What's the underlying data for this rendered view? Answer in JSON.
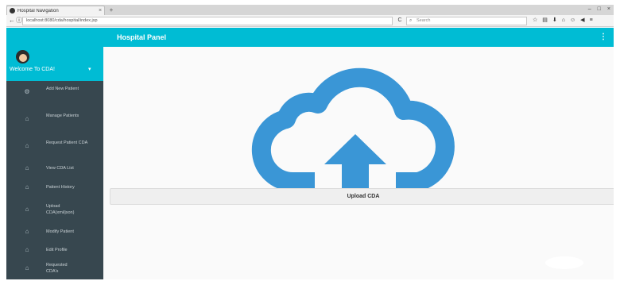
{
  "browser": {
    "tab_title": "Hospital Navigation",
    "tab_close": "×",
    "new_tab": "+",
    "window_controls": [
      "–",
      "□",
      "×"
    ],
    "back": "←",
    "info": "ⓘ",
    "url": "localhost:8080/cda/hospital/index.jsp",
    "reload": "C",
    "search_placeholder": "Search",
    "toolbar_icons": [
      "☆",
      "▤",
      "⬇",
      "⌂",
      "☺",
      "◀",
      "≡"
    ]
  },
  "header": {
    "panel_title": "Hospital Panel",
    "menu_icon": "⋮"
  },
  "sidebar": {
    "welcome": "Welcome To CDA!",
    "caret": "▾",
    "items": [
      {
        "label": "Add New Patient",
        "icon": "⚙"
      },
      {
        "label": "Manage Patients",
        "icon": "⌂"
      },
      {
        "label": "Request Patient CDA",
        "icon": "⌂"
      },
      {
        "label": "View CDA List",
        "icon": "⌂"
      },
      {
        "label": "Patient History",
        "icon": "⌂"
      },
      {
        "label": "Upload CDA(xml/json)",
        "icon": "⌂"
      },
      {
        "label": "Modify Patient",
        "icon": "⌂"
      },
      {
        "label": "Edit Profile",
        "icon": "⌂"
      },
      {
        "label": "Requested CDA's",
        "icon": "⌂"
      }
    ]
  },
  "main": {
    "upload_label": "Upload CDA",
    "cloud_color": "#3a96d6"
  },
  "colors": {
    "accent": "#00bcd4",
    "sidebar": "#37474f"
  }
}
